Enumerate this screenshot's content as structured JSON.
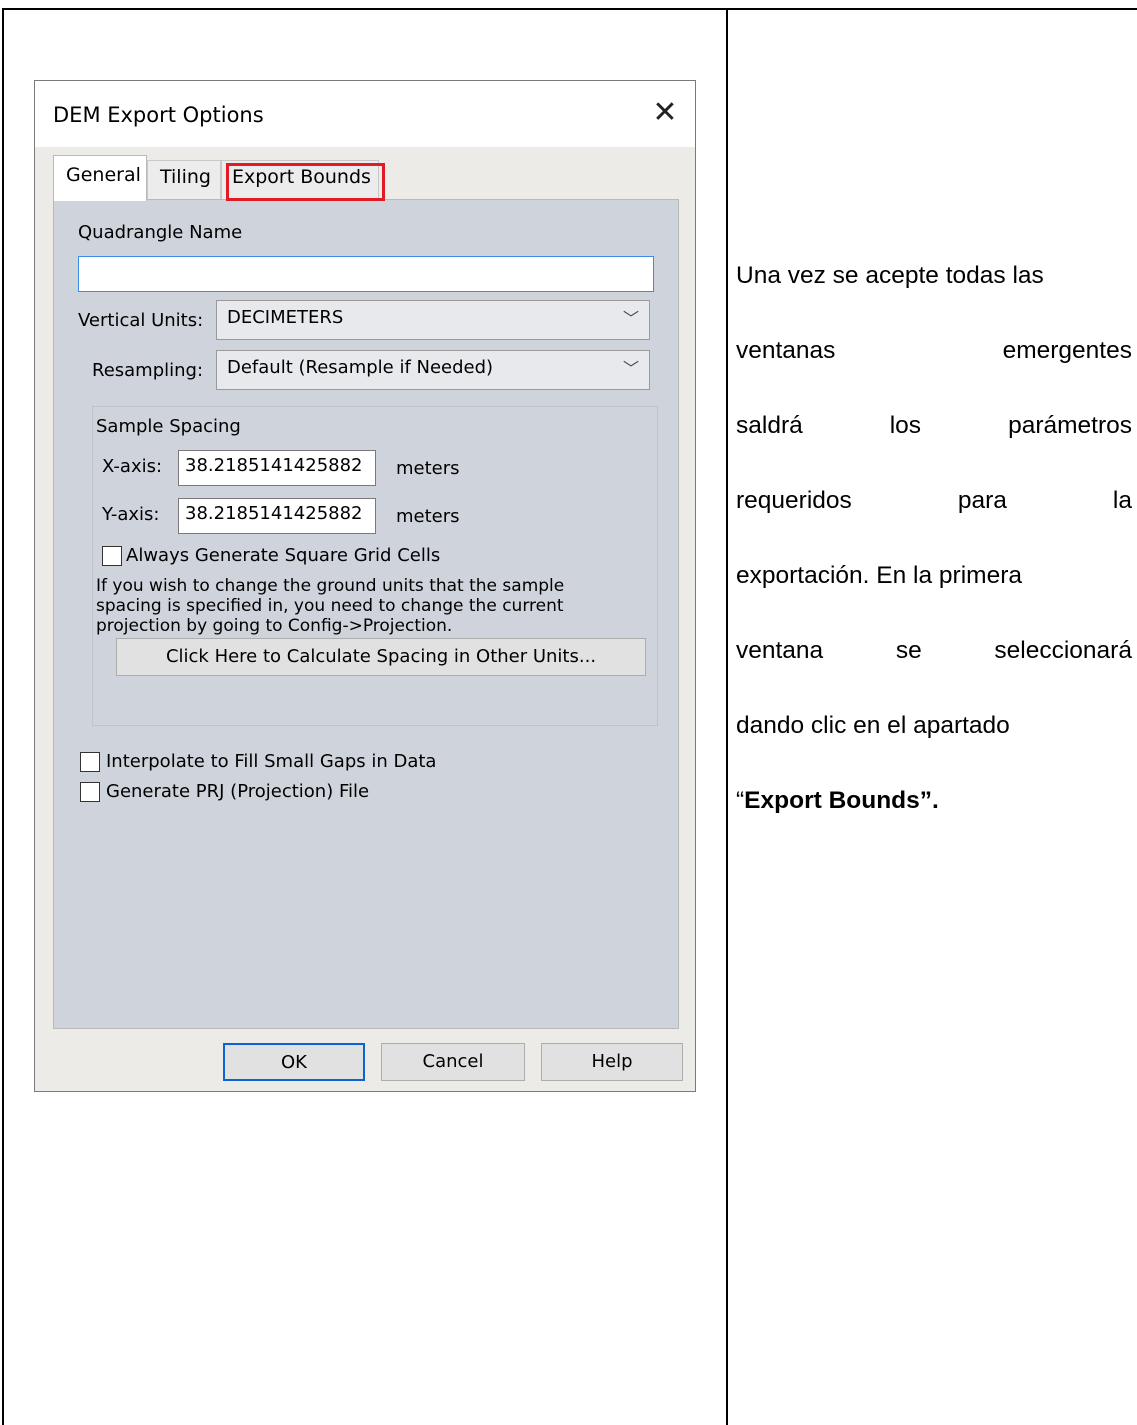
{
  "dialog": {
    "title": "DEM Export Options",
    "close_glyph": "✕",
    "tabs": [
      {
        "label": "General"
      },
      {
        "label": "Tiling"
      },
      {
        "label": "Export Bounds"
      }
    ],
    "quadrangle": {
      "label": "Quadrangle Name",
      "value": ""
    },
    "vertical_units": {
      "label": "Vertical Units:",
      "value": "DECIMETERS"
    },
    "resampling": {
      "label": "Resampling:",
      "value": "Default (Resample if Needed)"
    },
    "sample_spacing": {
      "title": "Sample Spacing",
      "x_label": "X-axis:",
      "x_value": "38.2185141425882",
      "y_label": "Y-axis:",
      "y_value": "38.2185141425882",
      "unit": "meters",
      "square_cells_label": "Always Generate Square Grid Cells",
      "info_lines": [
        "If you wish to change the ground units that the sample",
        "spacing is specified in, you need to change the current",
        "projection by going to Config->Projection."
      ],
      "calc_button": "Click Here to Calculate Spacing in Other Units..."
    },
    "interpolate_label": "Interpolate to Fill Small Gaps in Data",
    "prj_label": "Generate PRJ (Projection) File",
    "buttons": {
      "ok": "OK",
      "cancel": "Cancel",
      "help": "Help"
    }
  },
  "description": {
    "line1": "Una vez se acepte todas las",
    "line2": [
      "ventanas",
      "emergentes"
    ],
    "line3": [
      "saldrá",
      "los",
      "parámetros"
    ],
    "line4": [
      "requeridos",
      "para",
      "la"
    ],
    "line5": "exportación. En la primera",
    "line6": [
      "ventana",
      "se",
      "seleccionará"
    ],
    "line7": "dando clic en el apartado",
    "line8_open_quote": "“",
    "line8_bold": "Export Bounds”."
  },
  "colors": {
    "highlight": "#e01b24",
    "panel": "#cfd3db",
    "focus": "#3c8ce7"
  }
}
